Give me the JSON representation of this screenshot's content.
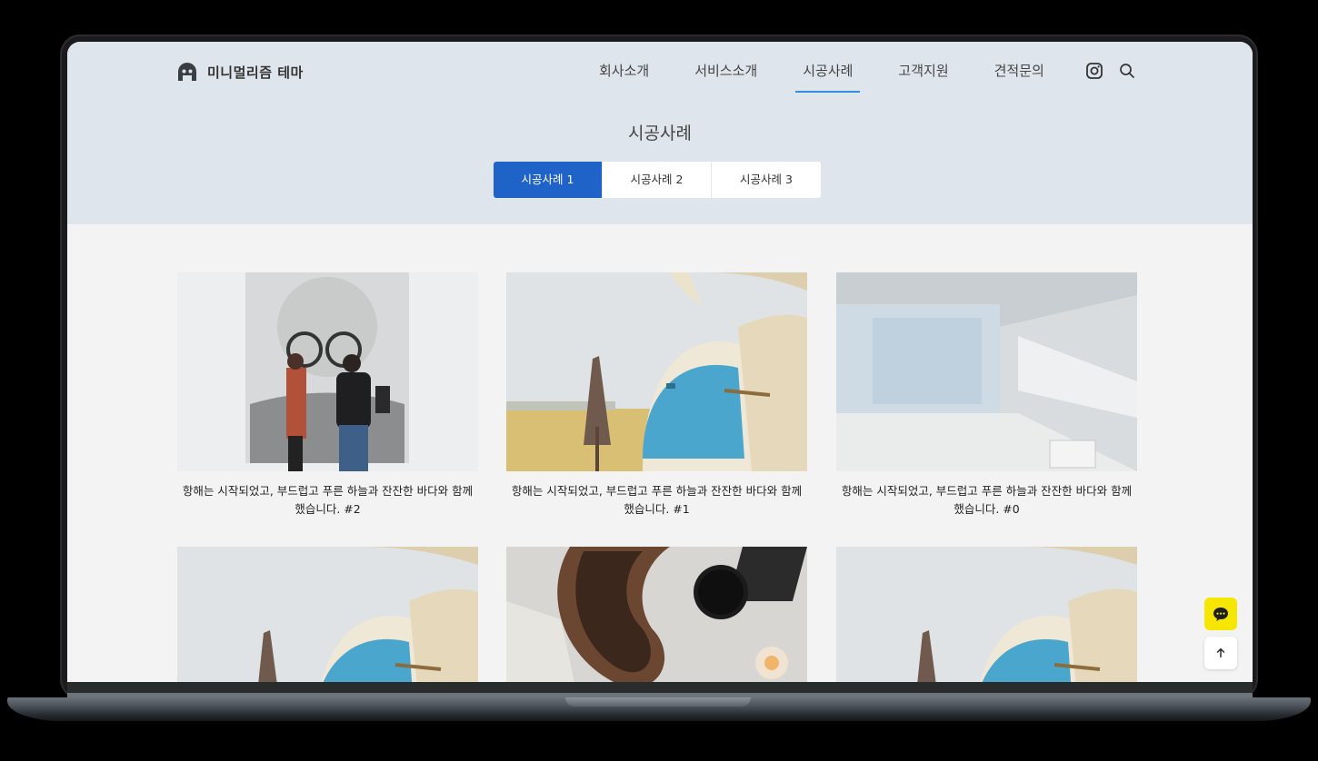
{
  "site": {
    "logo_text": "미니멀리즘 테마"
  },
  "nav": {
    "items": [
      {
        "label": "회사소개",
        "active": false
      },
      {
        "label": "서비스소개",
        "active": false
      },
      {
        "label": "시공사례",
        "active": true
      },
      {
        "label": "고객지원",
        "active": false
      },
      {
        "label": "견적문의",
        "active": false
      }
    ],
    "icons": [
      "instagram-icon",
      "search-icon"
    ]
  },
  "page": {
    "title": "시공사례"
  },
  "tabs": [
    {
      "label": "시공사례 1",
      "active": true
    },
    {
      "label": "시공사례 2",
      "active": false
    },
    {
      "label": "시공사례 3",
      "active": false
    }
  ],
  "gallery": {
    "items": [
      {
        "caption_line1": "항해는 시작되었고, 부드럽고 푸른 하늘과 잔잔한 바다와 함께",
        "caption_line2": "했습니다. #2",
        "image": "gallery-visitors"
      },
      {
        "caption_line1": "항해는 시작되었고, 부드럽고 푸른 하늘과 잔잔한 바다와 함께",
        "caption_line2": "했습니다. #1",
        "image": "blue-dome-terrace"
      },
      {
        "caption_line1": "항해는 시작되었고, 부드럽고 푸른 하늘과 잔잔한 바다와 함께",
        "caption_line2": "했습니다. #0",
        "image": "empty-white-room"
      },
      {
        "image": "blue-dome-terrace"
      },
      {
        "image": "stone-bowl-candle"
      },
      {
        "image": "blue-dome-terrace"
      }
    ]
  },
  "floating": {
    "chat_icon": "chat-icon",
    "top_icon": "arrow-up-icon"
  },
  "colors": {
    "accent": "#1f63c9",
    "nav_underline": "#2f8fe0",
    "hero_bg": "#dfe5ec",
    "chat": "#f7e600"
  }
}
